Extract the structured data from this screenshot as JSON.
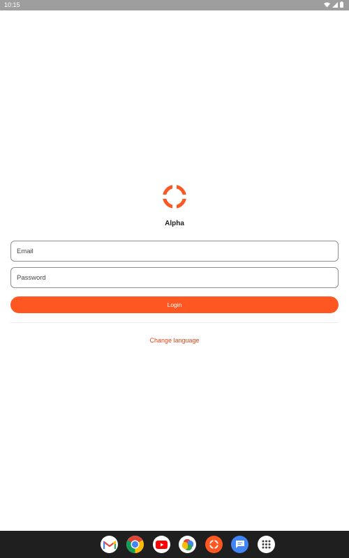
{
  "status_bar": {
    "time": "10:15",
    "icons": [
      "wifi-icon",
      "signal-icon",
      "battery-icon"
    ]
  },
  "app": {
    "name": "Alpha",
    "logo_icon": "alpha-logo-icon",
    "accent_color": "#ff5722"
  },
  "form": {
    "email_placeholder": "Email",
    "password_placeholder": "Password",
    "login_label": "Login"
  },
  "links": {
    "change_language": "Change language"
  },
  "dock": {
    "apps": [
      "gmail-icon",
      "chrome-icon",
      "youtube-icon",
      "photos-icon",
      "alpha-app-icon",
      "messages-icon",
      "app-drawer-icon"
    ]
  }
}
